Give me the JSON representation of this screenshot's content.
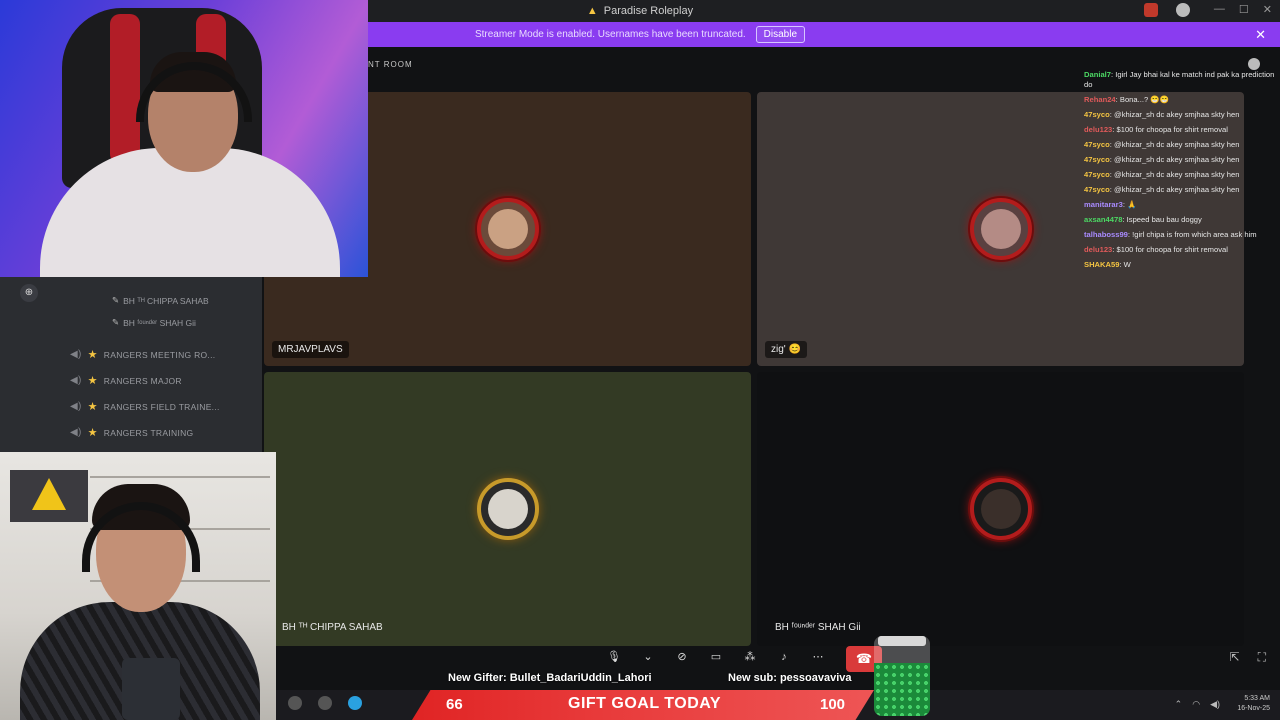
{
  "window": {
    "title": "Paradise Roleplay"
  },
  "banner": {
    "message": "Streamer Mode is enabled. Usernames have been truncated.",
    "disable_label": "Disable",
    "close_glyph": "✕"
  },
  "voice": {
    "room_label": "NT ROOM",
    "tiles": [
      {
        "name": "MRJAVPLAVS",
        "bg": "#3a2a1f",
        "ring": "red"
      },
      {
        "name": "zig' 😊",
        "bg": "#3f3836",
        "ring": "red"
      },
      {
        "name": "BH ᵀᴴ CHIPPA SAHAB",
        "bg": "#333a24",
        "ring": "gold"
      },
      {
        "name": "BH ᶠᵒᵘⁿᵈᵉʳ SHAH Gii",
        "bg": "#0f1012",
        "ring": "red"
      }
    ]
  },
  "sidebar": {
    "users": [
      {
        "label": "BH ᵀᴴ CHIPPA SAHAB"
      },
      {
        "label": "BH ᶠᵒᵘⁿᵈᵉʳ SHAH Gii"
      }
    ],
    "channels": [
      {
        "label": "RANGERS MEETING RO..."
      },
      {
        "label": "RANGERS MAJOR"
      },
      {
        "label": "RANGERS FIELD TRAINE..."
      },
      {
        "label": "RANGERS TRAINING"
      }
    ]
  },
  "chat": [
    {
      "user": "Danial7",
      "color": "#4cd964",
      "text": ": Igirl Jay bhai kal ke match ind pak ka prediction do"
    },
    {
      "user": "Rehan24",
      "color": "#e05a5a",
      "text": ": Bona...? 😁😁"
    },
    {
      "user": "47syco",
      "color": "#f5c542",
      "text": ": @khizar_sh dc akey smjhaa skty hen"
    },
    {
      "user": "delu123",
      "color": "#e05a5a",
      "text": ": $100 for choopa for shirt removal"
    },
    {
      "user": "47syco",
      "color": "#f5c542",
      "text": ": @khizar_sh dc akey smjhaa skty hen"
    },
    {
      "user": "47syco",
      "color": "#f5c542",
      "text": ": @khizar_sh dc akey smjhaa skty hen"
    },
    {
      "user": "47syco",
      "color": "#f5c542",
      "text": ": @khizar_sh dc akey smjhaa skty hen"
    },
    {
      "user": "47syco",
      "color": "#f5c542",
      "text": ": @khizar_sh dc akey smjhaa skty hen"
    },
    {
      "user": "manitarar3",
      "color": "#a98bff",
      "text": ": 🙏"
    },
    {
      "user": "axsan4478",
      "color": "#4cd964",
      "text": ": Ispeed bau bau doggy"
    },
    {
      "user": "talhaboss99",
      "color": "#a98bff",
      "text": ": !girl chipa is from which area ask him"
    },
    {
      "user": "delu123",
      "color": "#e05a5a",
      "text": ": $100 for choopa for shirt removal"
    },
    {
      "user": "SHAKA59",
      "color": "#f5c542",
      "text": ": W"
    }
  ],
  "alerts": {
    "gifter": "New Gifter: Bullet_BadariUddin_Lahori",
    "sub": "New sub: pessoavaviva"
  },
  "goal": {
    "title": "GIFT GOAL TODAY",
    "current": "66",
    "target": "100",
    "progress": 0.66
  },
  "taskbar": {
    "time": "5:33 AM",
    "date": "16-Nov-25"
  },
  "icons": [
    "triangle-logo-icon",
    "help-icon",
    "close-icon",
    "mic-icon",
    "camera-off-icon",
    "screen-share-icon",
    "activities-icon",
    "soundboard-icon",
    "more-icon",
    "hangup-icon",
    "popout-icon",
    "fullscreen-icon",
    "chat-bubble-icon"
  ]
}
